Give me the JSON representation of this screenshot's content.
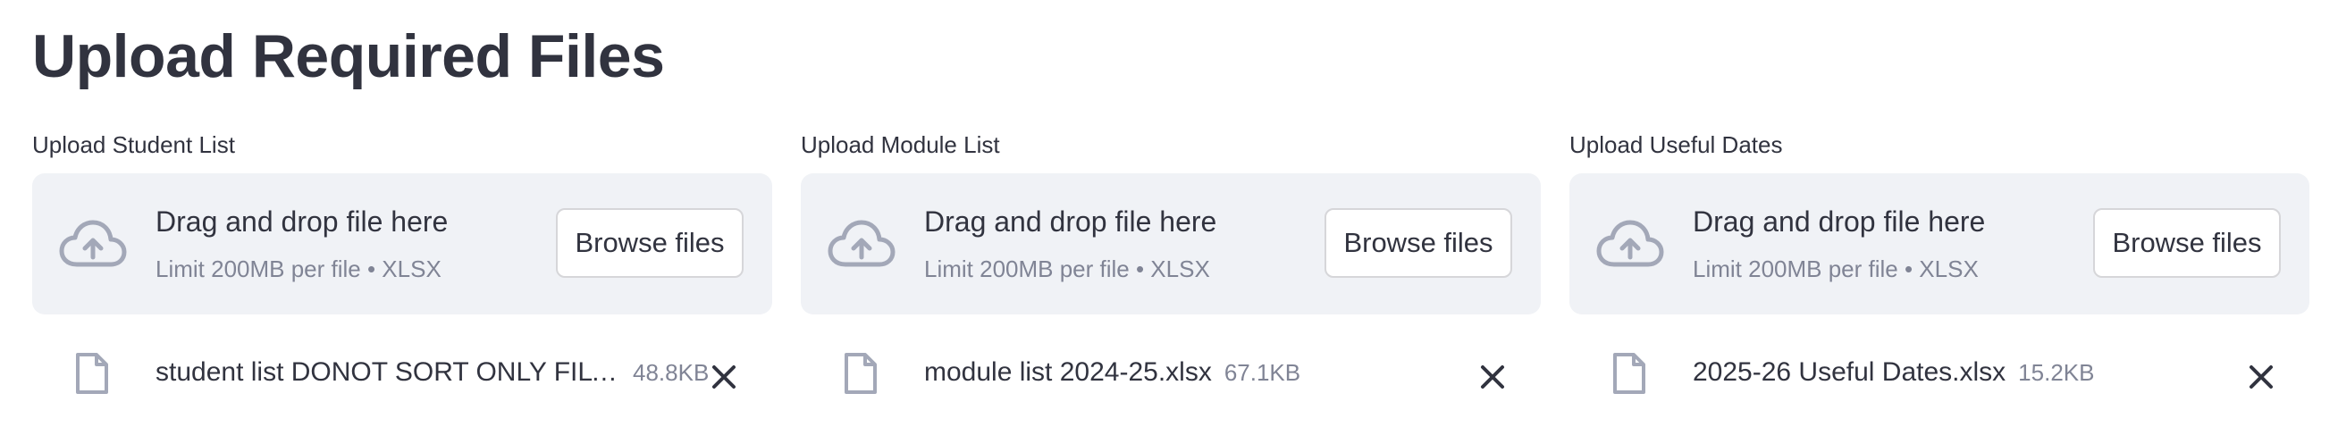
{
  "page_title": "Upload Required Files",
  "uploaders": [
    {
      "label": "Upload Student List",
      "dropzone_title": "Drag and drop file here",
      "dropzone_limit": "Limit 200MB per file • XLSX",
      "browse_label": "Browse files",
      "file_name": "student list DONOT SORT ONLY FILTE…",
      "file_size": "48.8KB"
    },
    {
      "label": "Upload Module List",
      "dropzone_title": "Drag and drop file here",
      "dropzone_limit": "Limit 200MB per file • XLSX",
      "browse_label": "Browse files",
      "file_name": "module list 2024-25.xlsx",
      "file_size": "67.1KB"
    },
    {
      "label": "Upload Useful Dates",
      "dropzone_title": "Drag and drop file here",
      "dropzone_limit": "Limit 200MB per file • XLSX",
      "browse_label": "Browse files",
      "file_name": "2025-26 Useful Dates.xlsx",
      "file_size": "15.2KB"
    }
  ],
  "icons": {
    "upload": "cloud-upload-icon",
    "file": "file-icon",
    "remove": "close-icon"
  },
  "colors": {
    "text": "#31333f",
    "muted": "#808495",
    "dropzone_bg": "#f0f2f6",
    "icon": "#a3a8b8"
  }
}
